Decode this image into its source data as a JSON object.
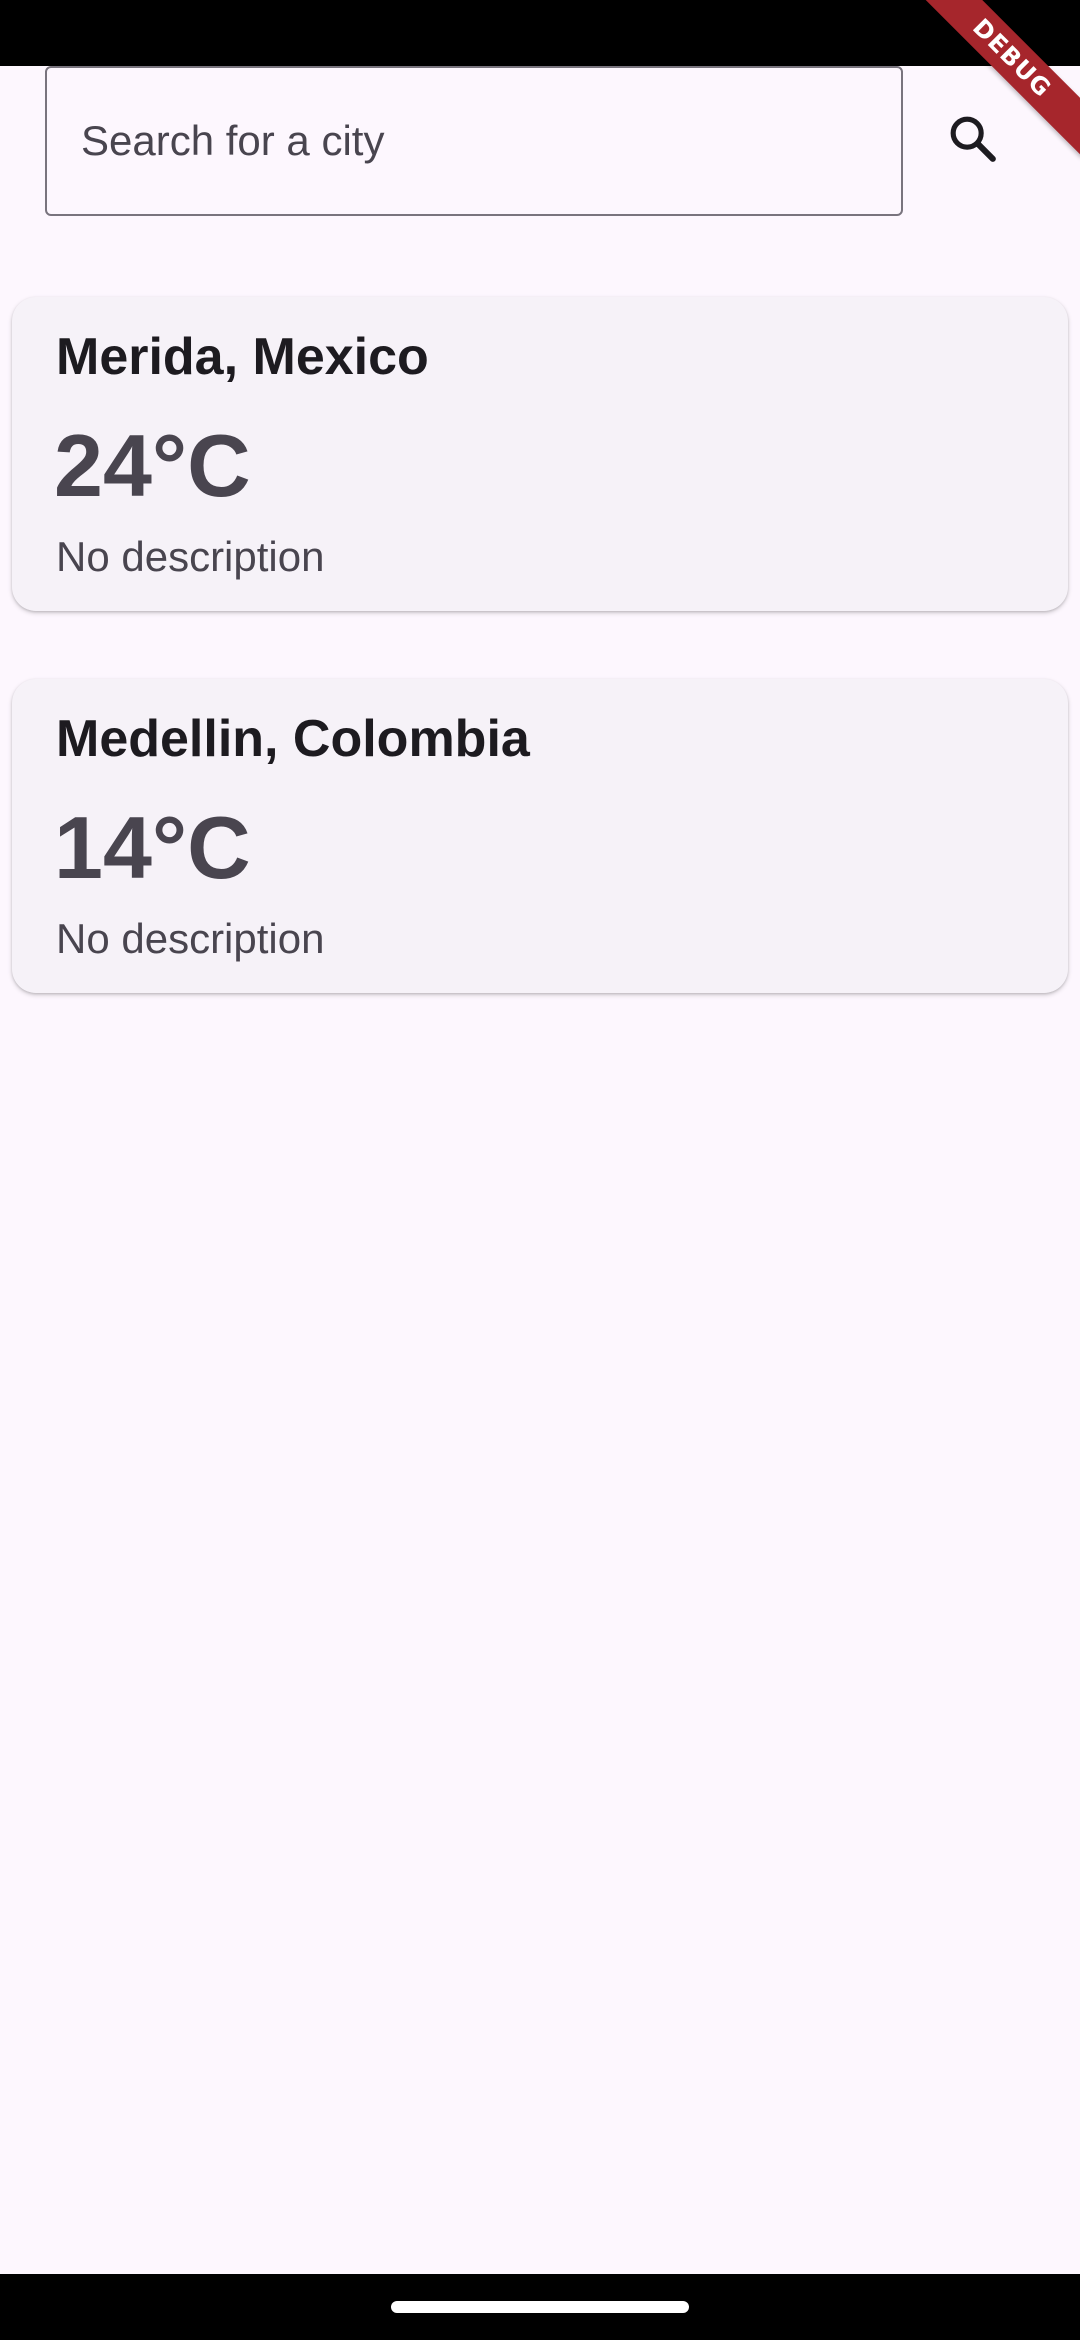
{
  "search": {
    "placeholder": "Search for a city",
    "value": "",
    "button_icon": "search-icon"
  },
  "debug_banner": {
    "label": "DEBUG",
    "color": "#a6262c"
  },
  "cities": [
    {
      "name": "Merida, Mexico",
      "temperature": "24°C",
      "description": "No description"
    },
    {
      "name": "Medellin, Colombia",
      "temperature": "14°C",
      "description": "No description"
    }
  ],
  "colors": {
    "background": "#fdf7fe",
    "card": "#f6f2f8",
    "title_text": "#1d1b20",
    "secondary_text": "#49454f",
    "outline": "#79747e"
  }
}
